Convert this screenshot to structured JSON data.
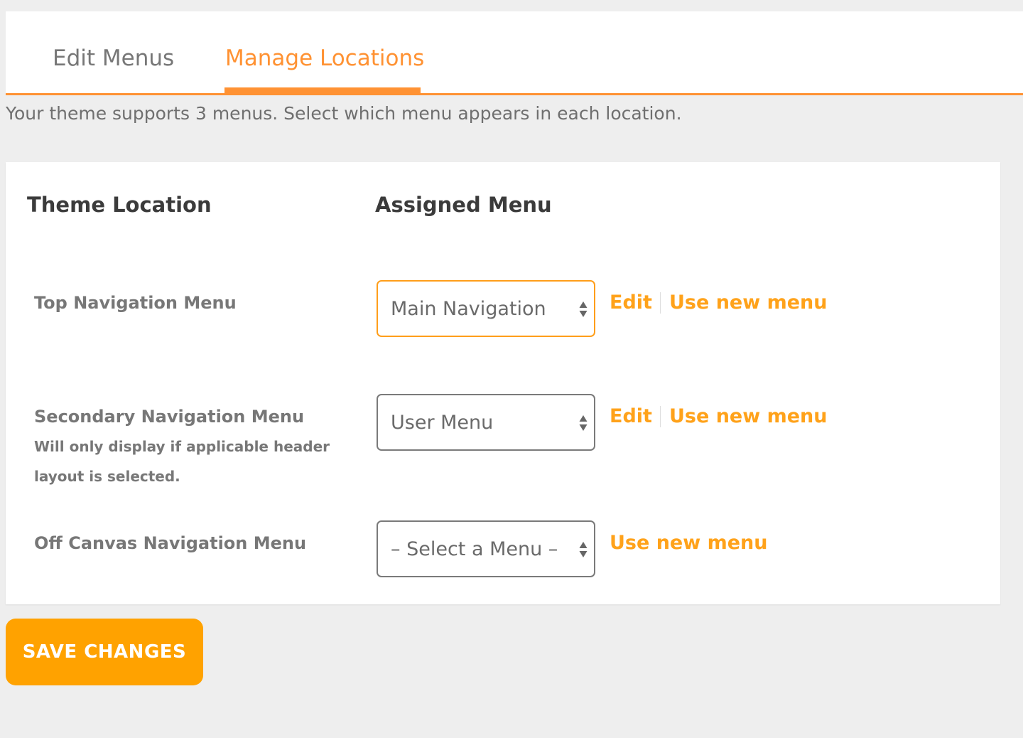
{
  "tabs": {
    "edit_menus": "Edit Menus",
    "manage_locations": "Manage Locations",
    "active": "manage_locations"
  },
  "intro_text": "Your theme supports 3 menus. Select which menu appears in each location.",
  "table": {
    "header_location": "Theme Location",
    "header_menu": "Assigned Menu",
    "rows": [
      {
        "location": "Top Navigation Menu",
        "description": "",
        "selected_menu": "Main Navigation",
        "edit_link": "Edit",
        "new_menu_link": "Use new menu"
      },
      {
        "location": "Secondary Navigation Menu",
        "description": "Will only display if applicable header layout is selected.",
        "selected_menu": "User Menu",
        "edit_link": "Edit",
        "new_menu_link": "Use new menu"
      },
      {
        "location": "Off Canvas Navigation Menu",
        "description": "",
        "selected_menu": "– Select a Menu –",
        "edit_link": "",
        "new_menu_link": "Use new menu"
      }
    ]
  },
  "save_button": "SAVE CHANGES",
  "colors": {
    "accent": "#ff9233",
    "link": "#ffa21a",
    "button": "#ffa200",
    "background": "#eeeeee"
  },
  "icons": {
    "select_arrows": "up-down-arrows-icon"
  }
}
